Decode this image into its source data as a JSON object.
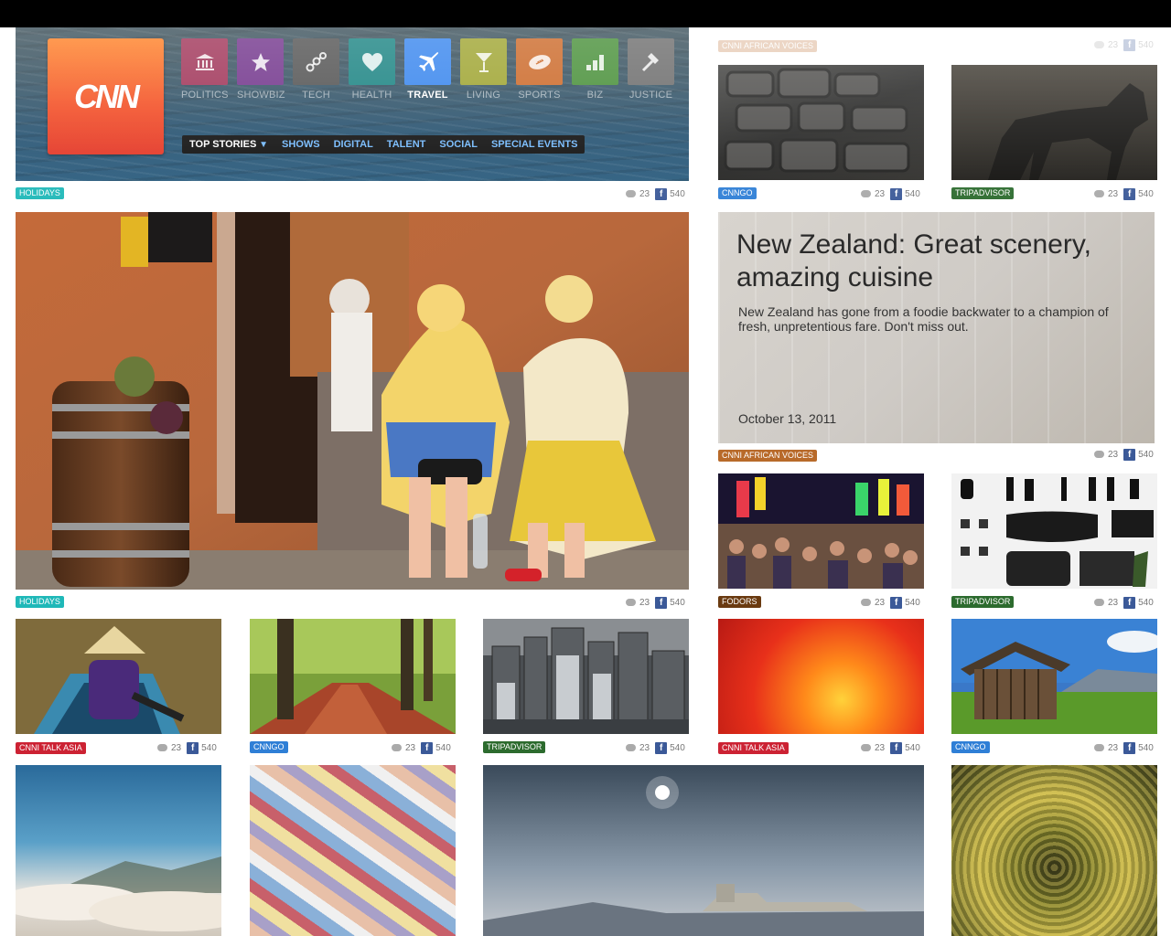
{
  "header": {
    "logo_text": "CNN",
    "nav": [
      {
        "label": "POLITICS",
        "icon": "capitol-icon",
        "color": "#9b2a50"
      },
      {
        "label": "SHOWBIZ",
        "icon": "star-icon",
        "color": "#6b2b86"
      },
      {
        "label": "TECH",
        "icon": "nodes-icon",
        "color": "#4a4a4a"
      },
      {
        "label": "HEALTH",
        "icon": "heart-icon",
        "color": "#0f7d7c"
      },
      {
        "label": "TRAVEL",
        "icon": "plane-icon",
        "color": "#2f80ed",
        "active": true
      },
      {
        "label": "LIVING",
        "icon": "cocktail-icon",
        "color": "#9aa027"
      },
      {
        "label": "SPORTS",
        "icon": "football-icon",
        "color": "#c9621f"
      },
      {
        "label": "BIZ",
        "icon": "chart-icon",
        "color": "#3f8a2f"
      },
      {
        "label": "JUSTICE",
        "icon": "gavel-icon",
        "color": "#666666"
      }
    ],
    "subnav": [
      "TOP STORIES",
      "SHOWS",
      "DIGITAL",
      "TALENT",
      "SOCIAL",
      "SPECIAL EVENTS"
    ]
  },
  "feature": {
    "title": "New Zealand: Great scenery, amazing cuisine",
    "summary": "New Zealand has gone from a foodie backwater to a champion of fresh, unpretentious fare. Don't miss out.",
    "date": "October 13, 2011"
  },
  "stats": {
    "comments": "23",
    "likes": "540",
    "fb_letter": "f"
  },
  "tags": {
    "holidays": "HOLIDAYS",
    "cnngo": "CNNGO",
    "tripadvisor": "TRIPADVISOR",
    "african_voices": "CNNI AFRICAN VOICES",
    "fodors": "FODORS",
    "talk_asia": "CNNI TALK ASIA"
  },
  "colors": {
    "holidays": "#1fb8b8",
    "cnngo": "#2f7fd6",
    "tripadvisor": "#2c6b2e",
    "african_voices": "#b86a2a",
    "fodors": "#6a3a10",
    "talk_asia": "#cc2233"
  }
}
